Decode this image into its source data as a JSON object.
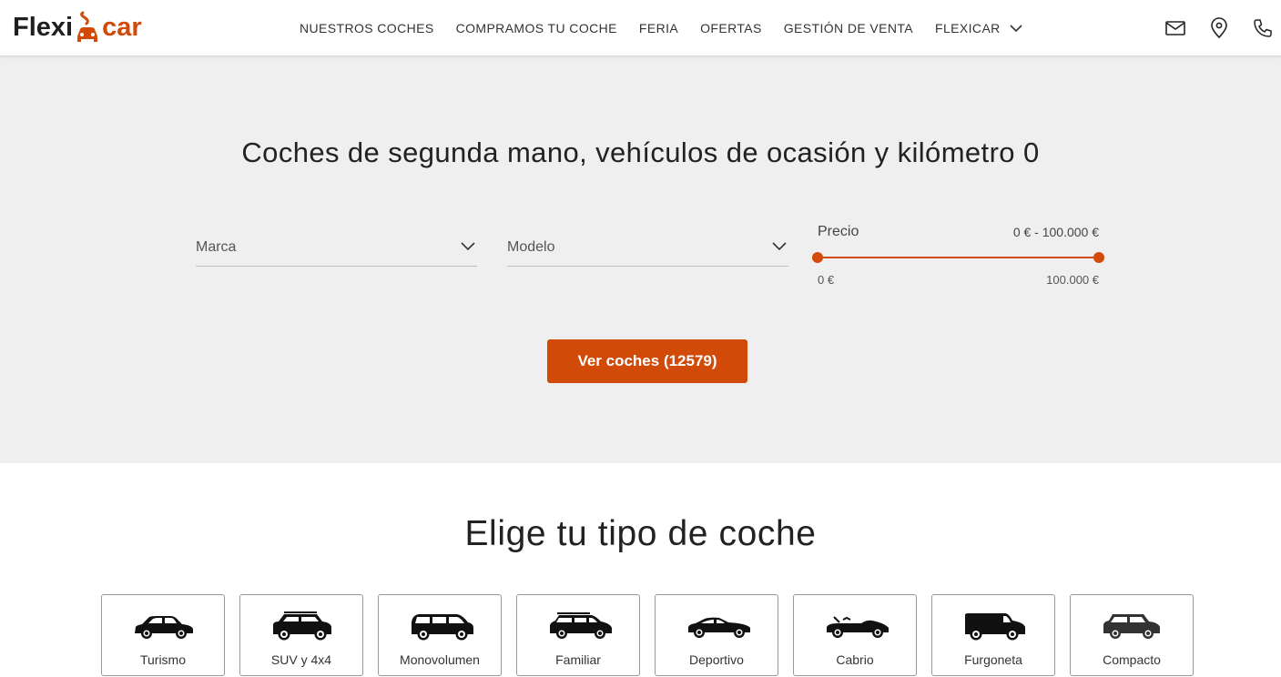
{
  "brand": {
    "part1": "Flexi",
    "part2": "car",
    "accent": "#d24a08"
  },
  "nav": [
    {
      "label": "NUESTROS COCHES"
    },
    {
      "label": "COMPRAMOS TU COCHE"
    },
    {
      "label": "FERIA"
    },
    {
      "label": "OFERTAS"
    },
    {
      "label": "GESTIÓN DE VENTA"
    },
    {
      "label": "FLEXICAR",
      "icon": "chevron-down-icon"
    }
  ],
  "header_icons": [
    "mail-icon",
    "location-pin-icon",
    "phone-icon"
  ],
  "hero": {
    "title": "Coches de segunda mano, vehículos de ocasión y kilómetro 0",
    "marca": {
      "label": "Marca"
    },
    "modelo": {
      "label": "Modelo"
    },
    "price": {
      "label": "Precio",
      "range": "0 € - 100.000 €",
      "min": "0 €",
      "max": "100.000 €",
      "low_fraction": 0,
      "high_fraction": 1
    },
    "cta": "Ver coches (12579)"
  },
  "types": {
    "title": "Elige tu tipo de coche",
    "items": [
      {
        "label": "Turismo",
        "icon": "sedan-icon"
      },
      {
        "label": "SUV y 4x4",
        "icon": "suv-icon"
      },
      {
        "label": "Monovolumen",
        "icon": "minivan-icon"
      },
      {
        "label": "Familiar",
        "icon": "wagon-icon"
      },
      {
        "label": "Deportivo",
        "icon": "sports-car-icon"
      },
      {
        "label": "Cabrio",
        "icon": "convertible-icon"
      },
      {
        "label": "Furgoneta",
        "icon": "van-icon"
      },
      {
        "label": "Compacto",
        "icon": "compact-car-icon"
      }
    ]
  }
}
